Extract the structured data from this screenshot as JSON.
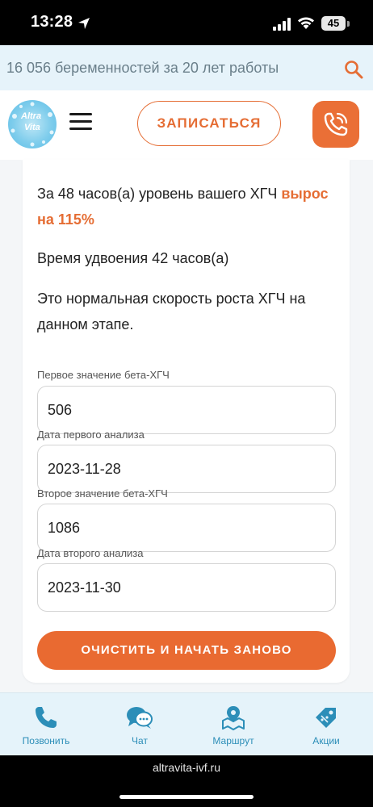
{
  "status_bar": {
    "time": "13:28",
    "battery": "45"
  },
  "banner": {
    "text": "16 056 беременностей за 20 лет работы"
  },
  "header": {
    "logo_line1": "Altra",
    "logo_line2": "Vita",
    "signup_label": "ЗАПИСАТЬСЯ"
  },
  "result": {
    "growth_prefix": "За 48 часов(а) уровень вашего ХГЧ ",
    "growth_highlight": "вырос на 115%",
    "doubling": "Время удвоения 42 часов(а)",
    "verdict": "Это нормальная скорость роста ХГЧ на данном этапе."
  },
  "form": {
    "first_value_label": "Первое значение бета-ХГЧ",
    "first_value": "506",
    "first_date_label": "Дата первого анализа",
    "first_date": "2023-11-28",
    "second_value_label": "Второе значение бета-ХГЧ",
    "second_value": "1086",
    "second_date_label": "Дата второго анализа",
    "second_date": "2023-11-30",
    "reset_label": "ОЧИСТИТЬ И НАЧАТЬ ЗАНОВО"
  },
  "bottom_nav": [
    {
      "label": "Позвонить",
      "icon": "phone-icon"
    },
    {
      "label": "Чат",
      "icon": "chat-icon"
    },
    {
      "label": "Маршрут",
      "icon": "map-pin-icon"
    },
    {
      "label": "Акции",
      "icon": "tag-icon"
    }
  ],
  "browser": {
    "url": "altravita-ivf.ru"
  },
  "colors": {
    "accent": "#e56d34",
    "nav_blue": "#2c8eb8",
    "banner_bg": "#e6f3fa"
  }
}
